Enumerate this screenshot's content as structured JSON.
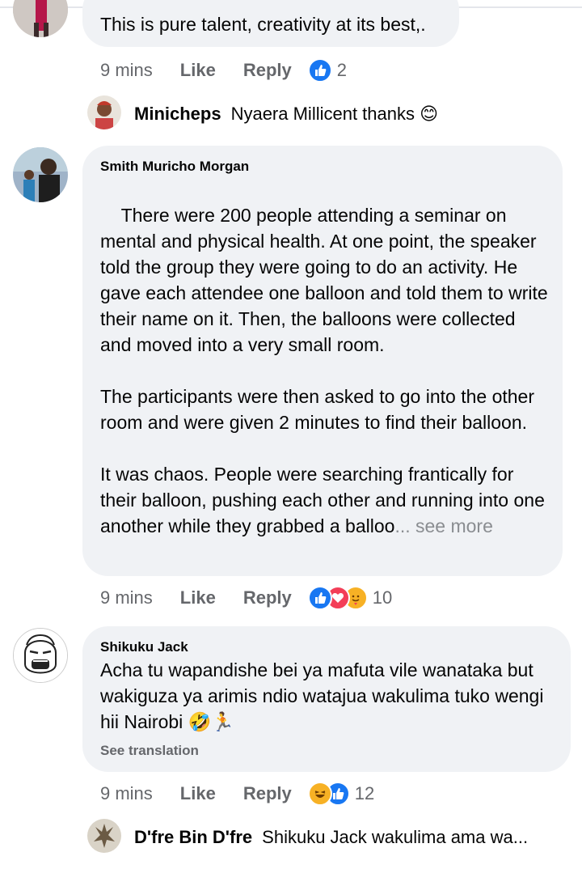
{
  "comments": [
    {
      "text": "This is pure talent, creativity at its best,.",
      "time": "9 mins",
      "like_label": "Like",
      "reply_label": "Reply",
      "reaction_count": "2",
      "reactions": [
        "like-icon"
      ]
    },
    {
      "author": "Smith Muricho Morgan",
      "text": "There were 200 people attending a seminar on mental and physical health. At one point, the speaker told the group they were going to do an activity. He gave each attendee one balloon and told them to write their name on it. Then, the balloons were collected and moved into a very small room.\n\nThe participants were then asked to go into the other room and were given 2 minutes to find their balloon.\n\nIt was chaos. People were searching frantically for their balloon, pushing each other and running into one another while they grabbed a balloo",
      "see_more": "... see more",
      "time": "9 mins",
      "like_label": "Like",
      "reply_label": "Reply",
      "reaction_count": "10",
      "reactions": [
        "like-icon",
        "love-icon",
        "care-icon"
      ]
    },
    {
      "author": "Shikuku Jack",
      "text": "Acha tu wapandishe bei ya mafuta vile wanataka but wakiguza ya arimis ndio watajua wakulima tuko wengi hii Nairobi 🤣🏃",
      "see_translation": "See translation",
      "time": "9 mins",
      "like_label": "Like",
      "reply_label": "Reply",
      "reaction_count": "12",
      "reactions": [
        "haha-icon",
        "like-icon"
      ]
    }
  ],
  "replies": [
    {
      "name": "Minicheps",
      "text": "Nyaera Millicent thanks 😊"
    },
    {
      "name": "D'fre Bin D'fre",
      "text": "Shikuku Jack wakulima ama wa..."
    }
  ],
  "colors": {
    "bubble": "#f0f2f5",
    "muted": "#65676b",
    "like_blue": "#1877f2",
    "love_red": "#f33e58",
    "haha_yellow": "#f7b125"
  }
}
